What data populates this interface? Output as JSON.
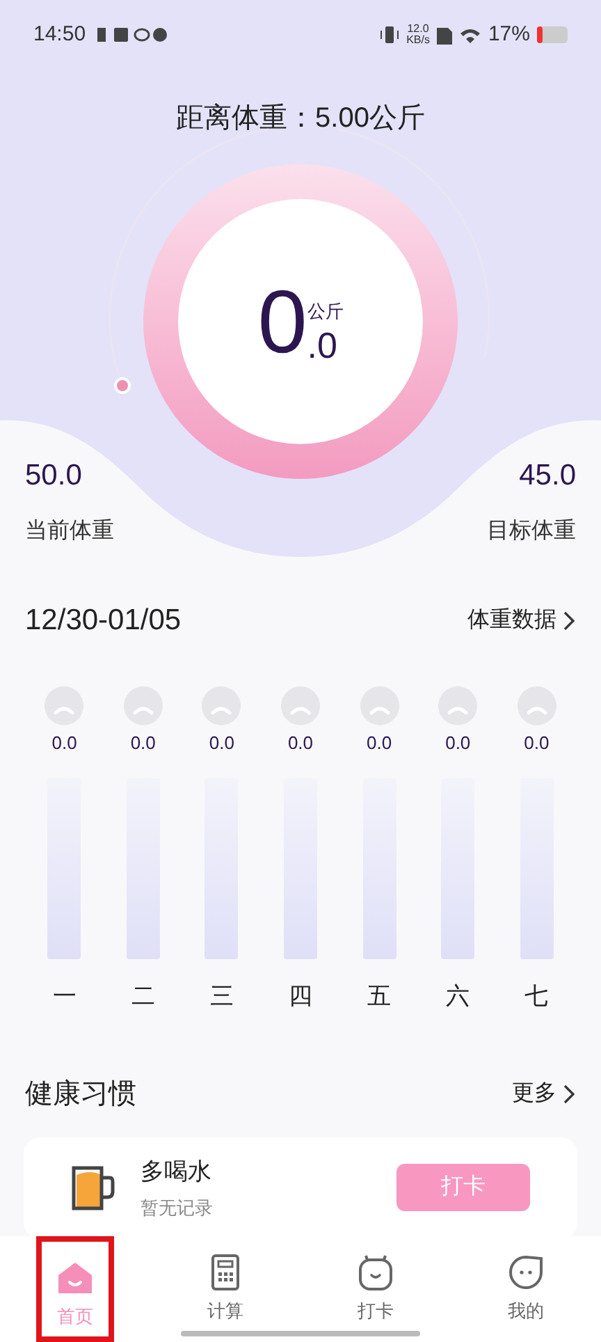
{
  "status_bar": {
    "time": "14:50",
    "net_speed_value": "12.0",
    "net_speed_unit": "KB/s",
    "battery": "17%"
  },
  "header": {
    "title": "距离体重：5.00公斤"
  },
  "gauge": {
    "integer": "0",
    "decimal": ".0",
    "unit": "公斤"
  },
  "current_weight": {
    "value": "50.0",
    "label": "当前体重"
  },
  "target_weight": {
    "value": "45.0",
    "label": "目标体重"
  },
  "week": {
    "range": "12/30-01/05",
    "link": "体重数据",
    "days": [
      {
        "value": "0.0",
        "label": "一"
      },
      {
        "value": "0.0",
        "label": "二"
      },
      {
        "value": "0.0",
        "label": "三"
      },
      {
        "value": "0.0",
        "label": "四"
      },
      {
        "value": "0.0",
        "label": "五"
      },
      {
        "value": "0.0",
        "label": "六"
      },
      {
        "value": "0.0",
        "label": "七"
      }
    ]
  },
  "habits": {
    "title": "健康习惯",
    "more": "更多",
    "items": [
      {
        "name": "多喝水",
        "note": "暂无记录",
        "action": "打卡"
      }
    ]
  },
  "nav": [
    {
      "kind": "home",
      "label": "首页",
      "selected": true,
      "highlighted": true
    },
    {
      "kind": "calc",
      "label": "计算",
      "selected": false,
      "highlighted": false
    },
    {
      "kind": "checkin",
      "label": "打卡",
      "selected": false,
      "highlighted": false
    },
    {
      "kind": "me",
      "label": "我的",
      "selected": false,
      "highlighted": false
    }
  ]
}
